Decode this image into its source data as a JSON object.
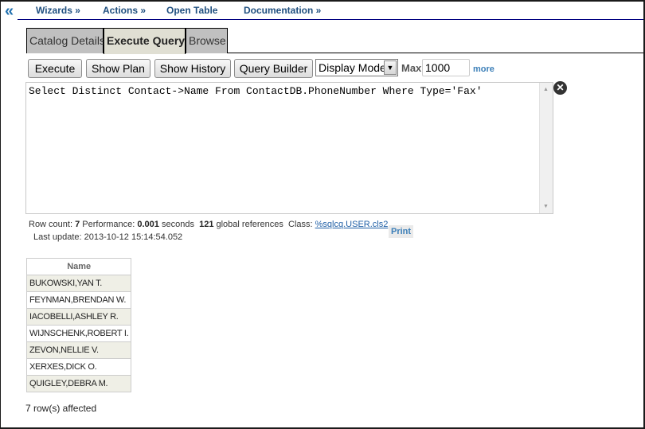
{
  "nav": {
    "collapse_icon": "double-chevron-left",
    "menu": [
      {
        "label": "Wizards »"
      },
      {
        "label": "Actions »"
      },
      {
        "label": "Open Table"
      },
      {
        "label": "Documentation »"
      }
    ]
  },
  "tabs": [
    {
      "label": "Catalog Details",
      "active": false
    },
    {
      "label": "Execute Query",
      "active": true
    },
    {
      "label": "Browse",
      "active": false
    }
  ],
  "toolbar": {
    "execute_label": "Execute",
    "show_plan_label": "Show Plan",
    "show_history_label": "Show History",
    "query_builder_label": "Query Builder",
    "display_mode": "Display Mode",
    "max_label": "Max",
    "max_value": "1000",
    "more_label": "more"
  },
  "query": {
    "text": "Select Distinct Contact->Name From ContactDB.PhoneNumber Where Type='Fax'",
    "clear_icon": "close-circle-icon"
  },
  "stats": {
    "row_count_label": "Row count:",
    "row_count": "7",
    "performance_label": "Performance:",
    "performance": "0.001",
    "seconds_label": "seconds",
    "global_refs": "121",
    "global_refs_label": "global references",
    "class_label": "Class:",
    "class_link": "%sqlcq.USER.cls2",
    "print_label": "Print",
    "last_update_label": "Last update:",
    "last_update": "2013-10-12 15:14:54.052"
  },
  "results": {
    "columns": [
      "Name"
    ],
    "rows": [
      "BUKOWSKI,YAN T.",
      "FEYNMAN,BRENDAN W.",
      "IACOBELLI,ASHLEY R.",
      "WIJNSCHENK,ROBERT I.",
      "ZEVON,NELLIE V.",
      "XERXES,DICK O.",
      "QUIGLEY,DEBRA M."
    ],
    "affected": "7 row(s) affected"
  }
}
